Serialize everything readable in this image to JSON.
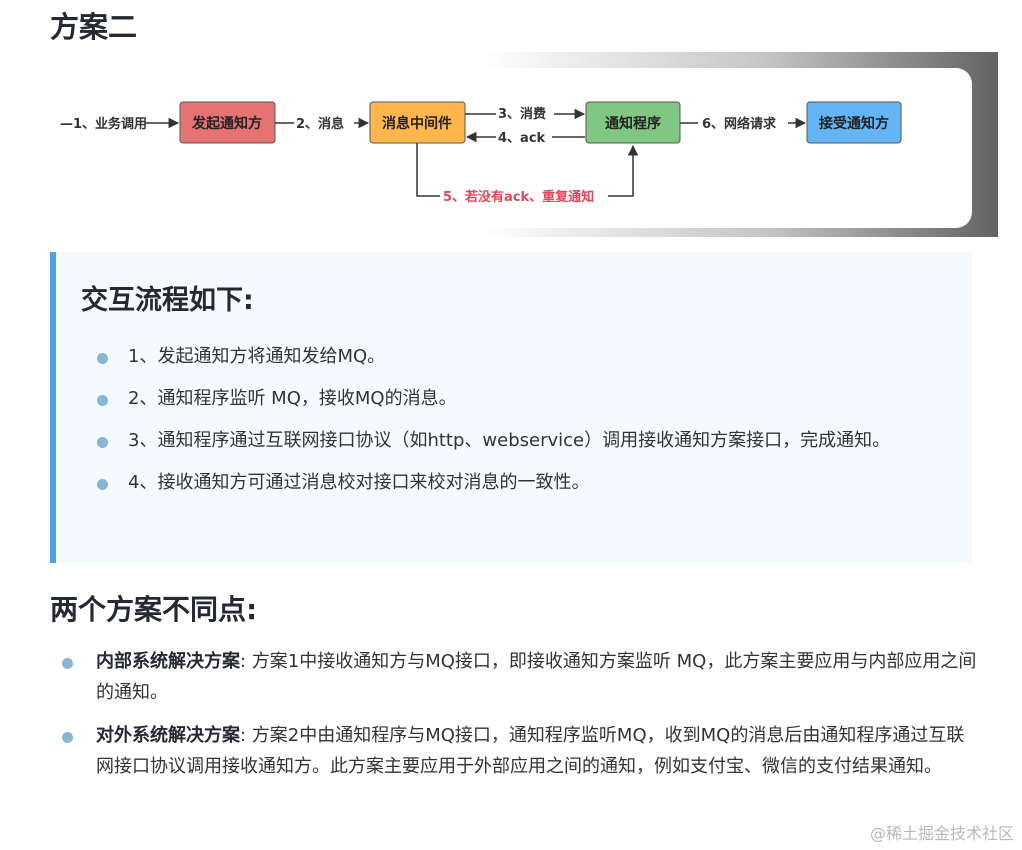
{
  "section_title": "方案二",
  "diagram": {
    "nodes": {
      "initiator": "发起通知方",
      "mq": "消息中间件",
      "notifier": "通知程序",
      "receiver": "接受通知方"
    },
    "edges": {
      "business_call": "—1、业务调用",
      "message": "2、消息",
      "consume": "3、消费",
      "ack": "4、ack",
      "network_request": "6、网络请求",
      "retry": "5、若没有ack、重复通知"
    },
    "colors": {
      "initiator": "#e57373",
      "mq": "#ffb74d",
      "notifier": "#81c784",
      "receiver": "#64b5f6",
      "retry_text": "#e0475b"
    }
  },
  "interaction": {
    "title": "交互流程如下:",
    "steps": [
      "1、发起通知方将通知发给MQ。",
      "2、通知程序监听 MQ，接收MQ的消息。",
      "3、通知程序通过互联网接口协议（如http、webservice）调用接收通知方案接口，完成通知。",
      "4、接收通知方可通过消息校对接口来校对消息的一致性。"
    ]
  },
  "differences": {
    "title": "两个方案不同点:",
    "items": [
      {
        "term": "内部系统解决方案",
        "text": ": 方案1中接收通知方与MQ接口，即接收通知方案监听 MQ，此方案主要应用与内部应用之间的通知。"
      },
      {
        "term": "对外系统解决方案",
        "text": ": 方案2中由通知程序与MQ接口，通知程序监听MQ，收到MQ的消息后由通知程序通过互联网接口协议调用接收通知方。此方案主要应用于外部应用之间的通知，例如支付宝、微信的支付结果通知。"
      }
    ]
  },
  "watermark": "@稀土掘金技术社区"
}
